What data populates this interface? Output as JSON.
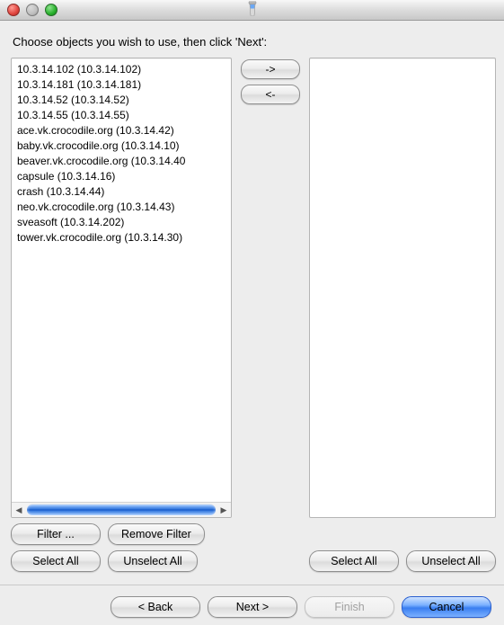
{
  "title": "",
  "instruction": "Choose objects you wish to use, then click 'Next':",
  "arrowButtons": {
    "right": "->",
    "left": "<-"
  },
  "leftList": {
    "items": [
      "10.3.14.102 (10.3.14.102)",
      "10.3.14.181 (10.3.14.181)",
      "10.3.14.52 (10.3.14.52)",
      "10.3.14.55 (10.3.14.55)",
      "ace.vk.crocodile.org (10.3.14.42)",
      "baby.vk.crocodile.org (10.3.14.10)",
      "beaver.vk.crocodile.org (10.3.14.40",
      "capsule (10.3.14.16)",
      "crash (10.3.14.44)",
      "neo.vk.crocodile.org (10.3.14.43)",
      "sveasoft (10.3.14.202)",
      "tower.vk.crocodile.org (10.3.14.30)"
    ],
    "buttons": {
      "filter": "Filter ...",
      "removeFilter": "Remove Filter",
      "selectAll": "Select All",
      "unselectAll": "Unselect All"
    }
  },
  "rightList": {
    "items": [],
    "buttons": {
      "selectAll": "Select All",
      "unselectAll": "Unselect All"
    }
  },
  "footer": {
    "back": "< Back",
    "next": "Next >",
    "finish": "Finish",
    "cancel": "Cancel"
  }
}
